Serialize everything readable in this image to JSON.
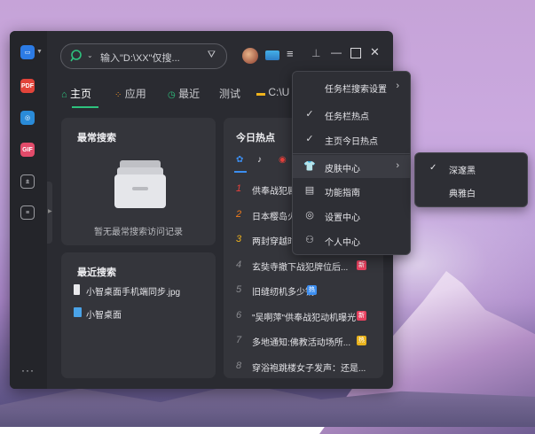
{
  "search": {
    "placeholder": "输入\"D:\\XX\"仅搜..."
  },
  "tabs": [
    {
      "label": "主页"
    },
    {
      "label": "应用"
    },
    {
      "label": "最近"
    },
    {
      "label": "测试"
    },
    {
      "label": "C:\\U"
    }
  ],
  "recent_search": {
    "title": "最常搜索",
    "empty_text": "暂无最常搜索访问记录"
  },
  "last_search": {
    "title": "最近搜索",
    "items": [
      {
        "label": "小智桌面手机端同步.jpg"
      },
      {
        "label": "小智桌面"
      }
    ]
  },
  "hot": {
    "title": "今日热点",
    "items": [
      {
        "rank": "1",
        "text": "供奉战犯剧",
        "rank_color": "#e8413c",
        "badge": "",
        "badge_color": ""
      },
      {
        "rank": "2",
        "text": "日本樱岛火",
        "rank_color": "#f07b1c",
        "badge": "",
        "badge_color": ""
      },
      {
        "rank": "3",
        "text": "两封穿越时",
        "rank_color": "#f0b31c",
        "badge": "",
        "badge_color": ""
      },
      {
        "rank": "4",
        "text": "玄奘寺撤下战犯牌位后...",
        "rank_color": "#8a8b90",
        "badge": "新",
        "badge_color": "#e8415f"
      },
      {
        "rank": "5",
        "text": "旧缝纫机多少钱",
        "rank_color": "#8a8b90",
        "badge": "热",
        "badge_color": "#3c8ef0"
      },
      {
        "rank": "6",
        "text": "\"吴啊萍\"供奉战犯动机曝光",
        "rank_color": "#8a8b90",
        "badge": "新",
        "badge_color": "#e8415f"
      },
      {
        "rank": "7",
        "text": "多地通知:佛教活动场所...",
        "rank_color": "#8a8b90",
        "badge": "热",
        "badge_color": "#e8b21c"
      },
      {
        "rank": "8",
        "text": "穿浴袍跳楼女子发声：还是...",
        "rank_color": "#8a8b90",
        "badge": "",
        "badge_color": ""
      }
    ]
  },
  "menu": {
    "items": [
      {
        "label": "任务栏搜索设置",
        "check": false,
        "arrow": true
      },
      {
        "label": "任务栏热点",
        "check": true,
        "arrow": false
      },
      {
        "label": "主页今日热点",
        "check": true,
        "arrow": false
      },
      {
        "label": "皮肤中心",
        "check": false,
        "arrow": true
      },
      {
        "label": "功能指南",
        "check": false,
        "arrow": false
      },
      {
        "label": "设置中心",
        "check": false,
        "arrow": false
      },
      {
        "label": "个人中心",
        "check": false,
        "arrow": false
      }
    ]
  },
  "skin_menu": {
    "items": [
      {
        "label": "深邃黑",
        "checked": true
      },
      {
        "label": "典雅白",
        "checked": false
      }
    ]
  },
  "colors": {
    "accent": "#2ec27e",
    "window_bg": "#2a2b31",
    "card_bg": "#34353b"
  }
}
